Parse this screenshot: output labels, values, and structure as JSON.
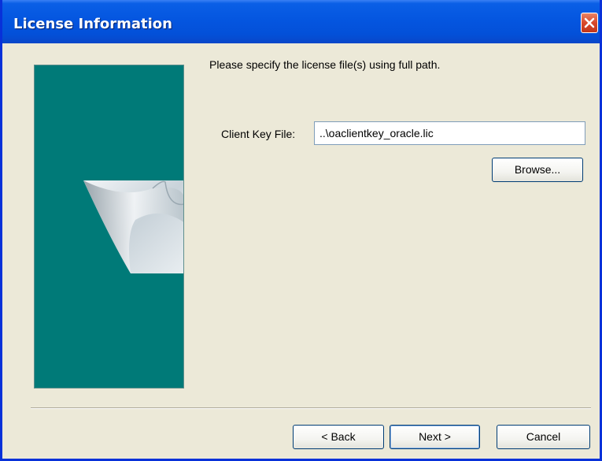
{
  "window": {
    "title": "License Information"
  },
  "main": {
    "instruction": "Please specify the license file(s) using full path.",
    "client_key_label": "Client Key File:",
    "client_key_value": "..\\oaclientkey_oracle.lic",
    "browse_label": "Browse..."
  },
  "footer": {
    "back_label": "< Back",
    "next_label": "Next >",
    "cancel_label": "Cancel"
  },
  "colors": {
    "titlebar": "#0455df",
    "side_panel": "#007a78",
    "dialog_bg": "#ece9d8",
    "close_button": "#d8492a"
  },
  "icons": {
    "close": "close-icon",
    "side_graphic": "page-curl-graphic"
  }
}
